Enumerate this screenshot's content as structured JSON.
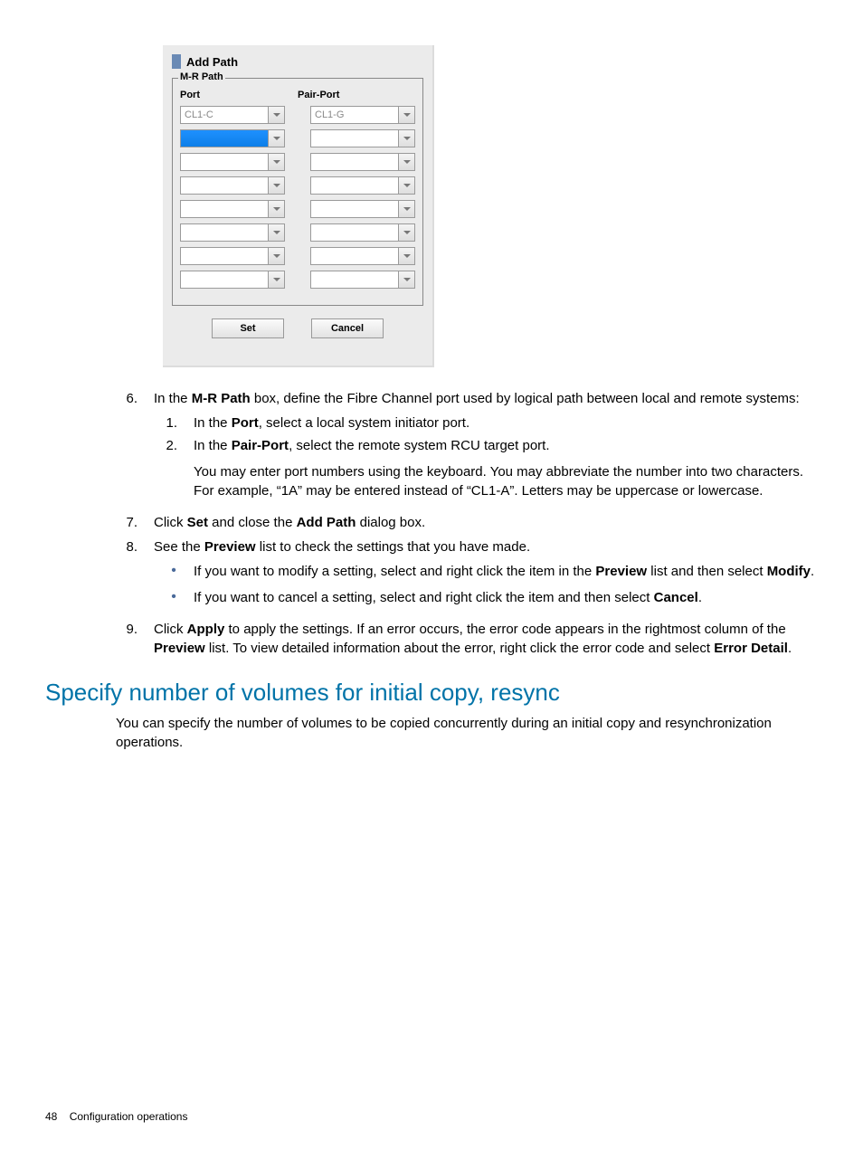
{
  "screenshot": {
    "title": "Add Path",
    "fieldset_legend": "M-R Path",
    "col1": "Port",
    "col2": "Pair-Port",
    "rows": [
      {
        "port": "CL1-C",
        "pair": "CL1-G",
        "sel": false
      },
      {
        "port": "",
        "pair": "",
        "sel": true
      },
      {
        "port": "",
        "pair": "",
        "sel": false
      },
      {
        "port": "",
        "pair": "",
        "sel": false
      },
      {
        "port": "",
        "pair": "",
        "sel": false
      },
      {
        "port": "",
        "pair": "",
        "sel": false
      },
      {
        "port": "",
        "pair": "",
        "sel": false
      },
      {
        "port": "",
        "pair": "",
        "sel": false
      }
    ],
    "set_btn": "Set",
    "cancel_btn": "Cancel"
  },
  "step6_num": "6.",
  "step6_intro_a": "In the ",
  "step6_intro_b": "M-R Path",
  "step6_intro_c": " box, define the Fibre Channel port used by logical path between local and remote systems:",
  "step6_1_num": "1.",
  "step6_1_a": "In the ",
  "step6_1_b": "Port",
  "step6_1_c": ", select a local system initiator port.",
  "step6_2_num": "2.",
  "step6_2_a": "In the ",
  "step6_2_b": "Pair-Port",
  "step6_2_c": ", select the remote system RCU target port.",
  "step6_note": "You may enter port numbers using the keyboard. You may abbreviate the number into two characters. For example, “1A” may be entered instead of “CL1-A”. Letters may be uppercase or lowercase.",
  "step7_num": "7.",
  "step7_a": "Click ",
  "step7_b": "Set",
  "step7_c": " and close the ",
  "step7_d": "Add Path",
  "step7_e": " dialog box.",
  "step8_num": "8.",
  "step8_a": "See the ",
  "step8_b": "Preview",
  "step8_c": " list to check the settings that you have made.",
  "step8_b1_a": "If you want to modify a setting, select and right click the item in the ",
  "step8_b1_b": "Preview",
  "step8_b1_c": " list and then select ",
  "step8_b1_d": "Modify",
  "step8_b1_e": ".",
  "step8_b2_a": "If you want to cancel a setting, select and right click the item and then select ",
  "step8_b2_b": "Cancel",
  "step8_b2_c": ".",
  "step9_num": "9.",
  "step9_a": "Click ",
  "step9_b": "Apply",
  "step9_c": " to apply the settings. If an error occurs, the error code appears in the rightmost column of the ",
  "step9_d": "Preview",
  "step9_e": " list. To view detailed information about the error, right click the error code and select ",
  "step9_f": "Error Detail",
  "step9_g": ".",
  "section_heading": "Specify number of volumes for initial copy, resync",
  "section_para": "You can specify the number of volumes to be copied concurrently during an initial copy and resynchronization operations.",
  "footer_page": "48",
  "footer_text": "Configuration operations"
}
